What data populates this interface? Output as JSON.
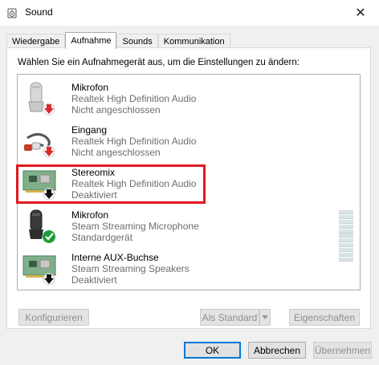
{
  "window": {
    "title": "Sound",
    "close_glyph": "✕"
  },
  "tabs": [
    {
      "label": "Wiedergabe",
      "active": false
    },
    {
      "label": "Aufnahme",
      "active": true
    },
    {
      "label": "Sounds",
      "active": false
    },
    {
      "label": "Kommunikation",
      "active": false
    }
  ],
  "instruction": "Wählen Sie ein Aufnahmegerät aus, um die Einstellungen zu ändern:",
  "devices": [
    {
      "name": "Mikrofon",
      "driver": "Realtek High Definition Audio",
      "status": "Nicht angeschlossen",
      "icon": "microphone-icon",
      "badge": "red-down-arrow"
    },
    {
      "name": "Eingang",
      "driver": "Realtek High Definition Audio",
      "status": "Nicht angeschlossen",
      "icon": "line-in-cable-icon",
      "badge": "red-down-arrow"
    },
    {
      "name": "Stereomix",
      "driver": "Realtek High Definition Audio",
      "status": "Deaktiviert",
      "icon": "sound-card-icon",
      "badge": "black-down-arrow",
      "highlighted": true
    },
    {
      "name": "Mikrofon",
      "driver": "Steam Streaming Microphone",
      "status": "Standardgerät",
      "icon": "microphone-icon",
      "badge": "green-check"
    },
    {
      "name": "Interne AUX-Buchse",
      "driver": "Steam Streaming Speakers",
      "status": "Deaktiviert",
      "icon": "sound-card-icon",
      "badge": "black-down-arrow"
    }
  ],
  "level_meter": {
    "level": 0
  },
  "buttons": {
    "configure": "Konfigurieren",
    "set_default": "Als Standard",
    "properties": "Eigenschaften",
    "ok": "OK",
    "cancel": "Abbrechen",
    "apply": "Übernehmen"
  },
  "colors": {
    "highlight": "#e0191e",
    "accent": "#0078d7"
  }
}
